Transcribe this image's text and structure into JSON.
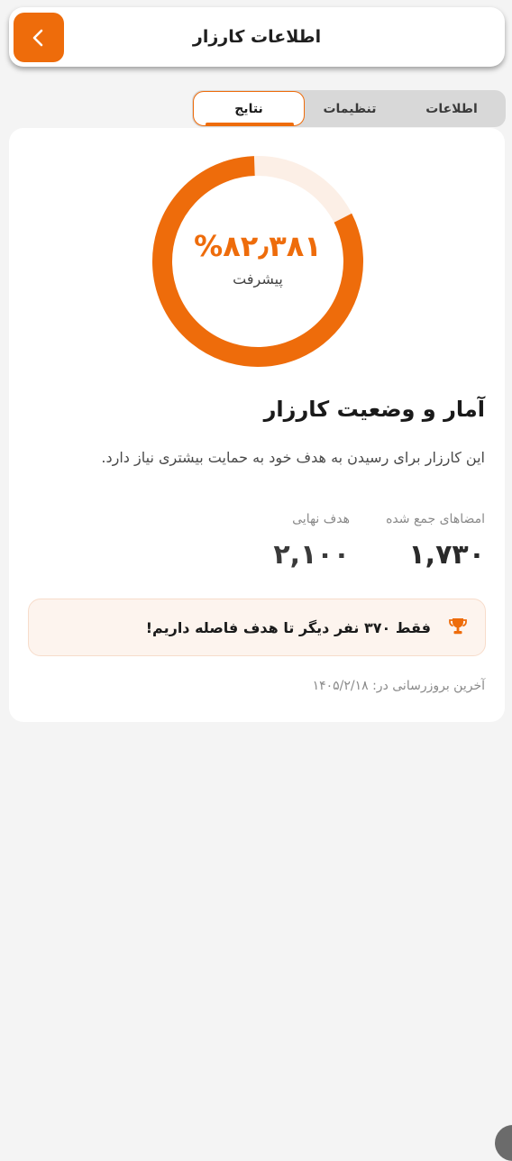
{
  "header": {
    "title": "اطلاعات کارزار",
    "back_icon": "chevron-left-icon"
  },
  "tabs": [
    {
      "label": "اطلاعات",
      "active": false
    },
    {
      "label": "تنظیمات",
      "active": false
    },
    {
      "label": "نتایج",
      "active": true
    }
  ],
  "progress": {
    "percent_text": "%۸۲٫۳۸۱",
    "label": "پیشرفت",
    "fraction": 0.82381
  },
  "stats": {
    "title": "آمار و وضعیت کارزار",
    "description": "این کارزار برای رسیدن به هدف خود به حمایت بیشتری نیاز دارد.",
    "collected_label": "امضاهای جمع شده",
    "collected_value": "۱,۷۳۰",
    "goal_label": "هدف نهایی",
    "goal_value": "۲,۱۰۰"
  },
  "banner": {
    "text": "فقط ۳۷۰ نفر دیگر تا هدف فاصله داریم!",
    "icon": "trophy-icon"
  },
  "last_update": "آخرین بروزرسانی در: ۱۴۰۵/۲/۱۸",
  "colors": {
    "accent": "#ee6c0b",
    "track": "#fcefe6",
    "background": "#f4f4f4"
  }
}
